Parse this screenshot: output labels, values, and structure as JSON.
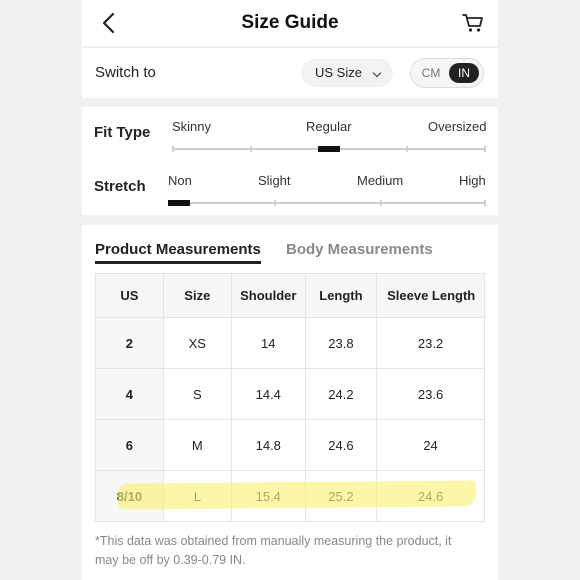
{
  "header": {
    "title": "Size Guide",
    "back_icon": "chevron-left-icon",
    "cart_icon": "cart-icon"
  },
  "switch": {
    "label": "Switch to",
    "selected_region": "US Size",
    "units": [
      "CM",
      "IN"
    ],
    "selected_unit": "IN"
  },
  "fit": {
    "fit_type": {
      "label": "Fit Type",
      "options": [
        "Skinny",
        "Regular",
        "Oversized"
      ],
      "selected": "Regular"
    },
    "stretch": {
      "label": "Stretch",
      "options": [
        "Non",
        "Slight",
        "Medium",
        "High"
      ],
      "selected": "Non"
    }
  },
  "tabs": {
    "active": "Product Measurements",
    "inactive": "Body Measurements"
  },
  "table": {
    "headers": [
      "US",
      "Size",
      "Shoulder",
      "Length",
      "Sleeve Length"
    ],
    "rows": [
      [
        "2",
        "XS",
        "14",
        "23.8",
        "23.2"
      ],
      [
        "4",
        "S",
        "14.4",
        "24.2",
        "23.6"
      ],
      [
        "6",
        "M",
        "14.8",
        "24.6",
        "24"
      ],
      [
        "8/10",
        "L",
        "15.4",
        "25.2",
        "24.6"
      ]
    ],
    "highlighted_row": "8/10",
    "highlight_color": "#fbf27a"
  },
  "note": "*This data was obtained from manually measuring the product, it may be off by 0.39-0.79 IN."
}
